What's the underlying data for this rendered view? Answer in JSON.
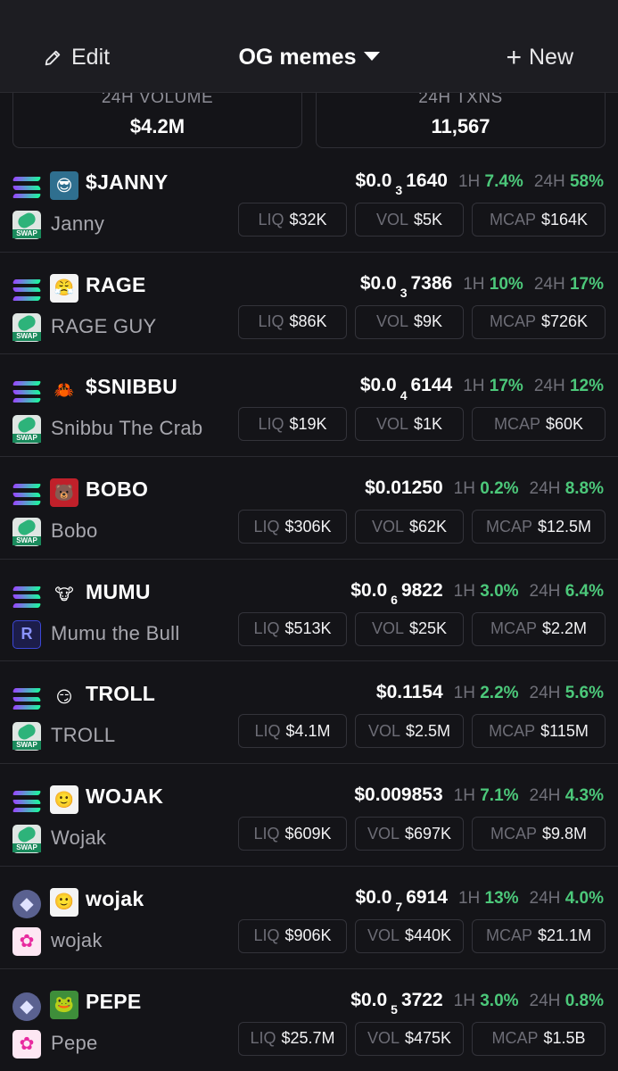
{
  "header": {
    "edit_label": "Edit",
    "title": "OG memes",
    "new_label": "New"
  },
  "stats": {
    "volume_label": "24H VOLUME",
    "volume_value": "$4.2M",
    "txns_label": "24H TXNS",
    "txns_value": "11,567"
  },
  "labels": {
    "h1": "1H",
    "h24": "24H",
    "liq": "LIQ",
    "vol": "VOL",
    "mcap": "MCAP"
  },
  "colors": {
    "positive": "#4cc87a",
    "background": "#141418",
    "header": "#1d1d22"
  },
  "tokens": [
    {
      "symbol": "$JANNY",
      "name": "Janny",
      "chain": "solana",
      "dex": "swap",
      "icon": "janny-avatar-icon",
      "price_main": "$0.0",
      "price_sub": "3",
      "price_rest": "1640",
      "h1": "7.4%",
      "h24": "58%",
      "liq": "$32K",
      "vol": "$5K",
      "mcap": "$164K"
    },
    {
      "symbol": "RAGE",
      "name": "RAGE GUY",
      "chain": "solana",
      "dex": "swap",
      "icon": "rage-face-icon",
      "price_main": "$0.0",
      "price_sub": "3",
      "price_rest": "7386",
      "h1": "10%",
      "h24": "17%",
      "liq": "$86K",
      "vol": "$9K",
      "mcap": "$726K"
    },
    {
      "symbol": "$SNIBBU",
      "name": "Snibbu The Crab",
      "chain": "solana",
      "dex": "swap",
      "icon": "crab-icon",
      "price_main": "$0.0",
      "price_sub": "4",
      "price_rest": "6144",
      "h1": "17%",
      "h24": "12%",
      "liq": "$19K",
      "vol": "$1K",
      "mcap": "$60K"
    },
    {
      "symbol": "BOBO",
      "name": "Bobo",
      "chain": "solana",
      "dex": "swap",
      "icon": "bear-icon",
      "price_main": "$0.01250",
      "price_sub": "",
      "price_rest": "",
      "h1": "0.2%",
      "h24": "8.8%",
      "liq": "$306K",
      "vol": "$62K",
      "mcap": "$12.5M"
    },
    {
      "symbol": "MUMU",
      "name": "Mumu the Bull",
      "chain": "solana",
      "dex": "raydium",
      "icon": "bull-icon",
      "price_main": "$0.0",
      "price_sub": "6",
      "price_rest": "9822",
      "h1": "3.0%",
      "h24": "6.4%",
      "liq": "$513K",
      "vol": "$25K",
      "mcap": "$2.2M"
    },
    {
      "symbol": "TROLL",
      "name": "TROLL",
      "chain": "solana",
      "dex": "swap",
      "icon": "trollface-icon",
      "price_main": "$0.1154",
      "price_sub": "",
      "price_rest": "",
      "h1": "2.2%",
      "h24": "5.6%",
      "liq": "$4.1M",
      "vol": "$2.5M",
      "mcap": "$115M"
    },
    {
      "symbol": "WOJAK",
      "name": "Wojak",
      "chain": "solana",
      "dex": "swap",
      "icon": "wojak-icon",
      "price_main": "$0.009853",
      "price_sub": "",
      "price_rest": "",
      "h1": "7.1%",
      "h24": "4.3%",
      "liq": "$609K",
      "vol": "$697K",
      "mcap": "$9.8M"
    },
    {
      "symbol": "wojak",
      "name": "wojak",
      "chain": "ethereum",
      "dex": "uniswap",
      "icon": "wojak-icon",
      "price_main": "$0.0",
      "price_sub": "7",
      "price_rest": "6914",
      "h1": "13%",
      "h24": "4.0%",
      "liq": "$906K",
      "vol": "$440K",
      "mcap": "$21.1M"
    },
    {
      "symbol": "PEPE",
      "name": "Pepe",
      "chain": "ethereum",
      "dex": "uniswap",
      "icon": "pepe-icon",
      "price_main": "$0.0",
      "price_sub": "5",
      "price_rest": "3722",
      "h1": "3.0%",
      "h24": "0.8%",
      "liq": "$25.7M",
      "vol": "$475K",
      "mcap": "$1.5B"
    }
  ]
}
